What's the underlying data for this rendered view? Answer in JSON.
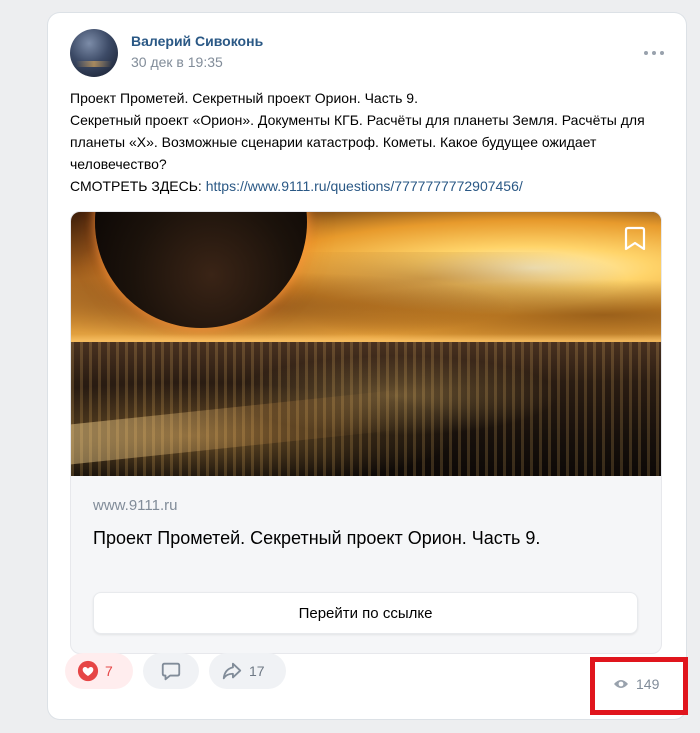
{
  "post": {
    "author": "Валерий Сивоконь",
    "date": "30 дек в 19:35",
    "lines": [
      "Проект Прометей. Секретный проект Орион. Часть 9.",
      "Секретный проект «Орион». Документы КГБ. Расчёты для планеты Земля. Расчёты для планеты «Х». Возможные сценарии катастроф. Кометы. Какое будущее ожидает человечество?"
    ],
    "link_prefix": "СМОТРЕТЬ ЗДЕСЬ: ",
    "link_url": "https://www.9111.ru/questions/7777777772907456/"
  },
  "attachment": {
    "site": "www.9111.ru",
    "title": "Проект Прометей. Секретный проект Орион. Часть 9.",
    "button_label": "Перейти по ссылке"
  },
  "actions": {
    "likes": "7",
    "reposts": "17",
    "views": "149"
  },
  "icons": {
    "more": "more-dots-icon",
    "bookmark": "bookmark-icon",
    "like": "heart-icon",
    "comment": "comment-icon",
    "share": "share-arrow-icon",
    "views": "eye-icon"
  },
  "colors": {
    "author_link": "#2a5885",
    "like_red": "#e64646",
    "highlight_box": "#e0151d"
  }
}
